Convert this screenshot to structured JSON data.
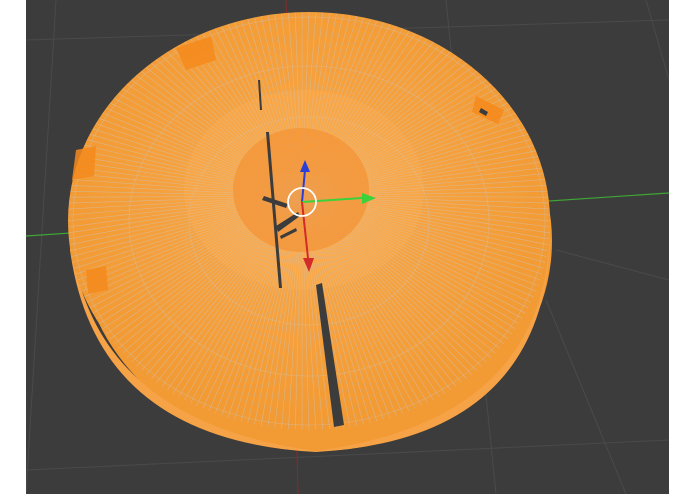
{
  "viewport": {
    "background_color": "#3c3c3c",
    "grid_color": "#4a4a4a",
    "mesh_color": "#f7a038",
    "mesh_wire_color": "#c9c9c9",
    "axis_x_color": "#3fa536",
    "axis_y_color": "#b03a3a",
    "gizmo_x_color": "#3bd13b",
    "gizmo_y_color": "#d32a2a",
    "gizmo_z_color": "#2b3fd6",
    "cursor_color": "#ffffff"
  },
  "selected_object": {
    "type": "cylinder-mesh",
    "mode": "edit-mode-wireframe"
  },
  "icons": {
    "transform_gizmo": "translate-gizmo-icon",
    "cursor": "3d-cursor-icon"
  }
}
